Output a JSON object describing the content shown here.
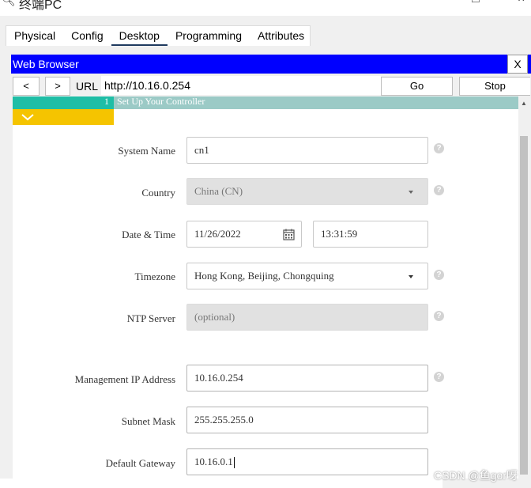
{
  "window": {
    "title": "终端PC"
  },
  "tabs": [
    {
      "label": "Physical",
      "active": false
    },
    {
      "label": "Config",
      "active": false
    },
    {
      "label": "Desktop",
      "active": true
    },
    {
      "label": "Programming",
      "active": false
    },
    {
      "label": "Attributes",
      "active": false
    }
  ],
  "browser": {
    "title": "Web Browser",
    "close_label": "X",
    "back_label": "<",
    "forward_label": ">",
    "url_label": "URL",
    "url": "http://10.16.0.254",
    "go_label": "Go",
    "stop_label": "Stop"
  },
  "step": {
    "number": "1",
    "title": "Set Up Your Controller"
  },
  "form": {
    "system_name": {
      "label": "System Name",
      "value": "cn1"
    },
    "country": {
      "label": "Country",
      "value": "China (CN)"
    },
    "date_time": {
      "label": "Date & Time",
      "date": "11/26/2022",
      "time": "13:31:59"
    },
    "timezone": {
      "label": "Timezone",
      "value": "Hong Kong, Beijing, Chongquing"
    },
    "ntp_server": {
      "label": "NTP Server",
      "placeholder": "(optional)"
    },
    "management_ip": {
      "label": "Management IP Address",
      "value": "10.16.0.254"
    },
    "subnet_mask": {
      "label": "Subnet Mask",
      "value": "255.255.255.0"
    },
    "default_gateway": {
      "label": "Default Gateway",
      "value": "10.16.0.1"
    }
  },
  "help_glyph": "?",
  "watermark": "CSDN @鱼gor呀",
  "colors": {
    "browser_title_bg": "#0000ff",
    "step_bar": "#9bcac6",
    "step_num": "#1fbea6",
    "collapse": "#f5c400",
    "tab_active_underline": "#1f3a5f"
  }
}
